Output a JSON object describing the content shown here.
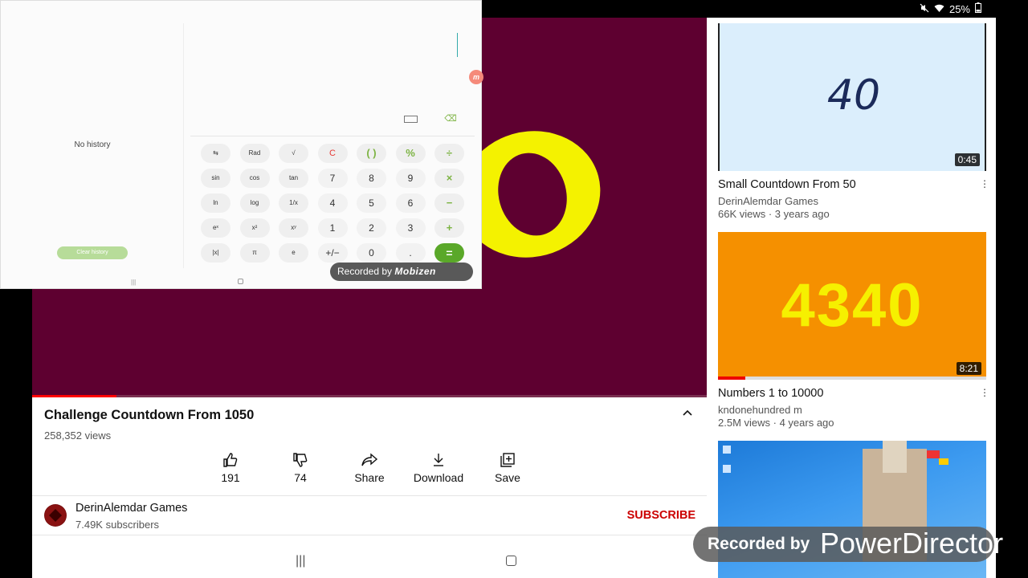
{
  "status_bar": {
    "battery": "25%"
  },
  "video": {
    "progress_fraction": 0.125
  },
  "calculator": {
    "history_empty_text": "No history",
    "clear_history_label": "Clear history",
    "keys": [
      "⇆",
      "Rad",
      "√",
      "C",
      "( )",
      "%",
      "÷",
      "sin",
      "cos",
      "tan",
      "7",
      "8",
      "9",
      "×",
      "ln",
      "log",
      "1/x",
      "4",
      "5",
      "6",
      "−",
      "eˣ",
      "x²",
      "xʸ",
      "1",
      "2",
      "3",
      "+",
      "|x|",
      "π",
      "e",
      "+/−",
      "0",
      ".",
      "="
    ],
    "watermark_prefix": "Recorded by",
    "watermark_brand": "Mobizen",
    "badge_letter": "m"
  },
  "main": {
    "title": "Challenge Countdown From 1050",
    "views": "258,352 views",
    "actions": {
      "like": "191",
      "dislike": "74",
      "share": "Share",
      "download": "Download",
      "save": "Save"
    },
    "channel": {
      "name": "DerinAlemdar Games",
      "subscribers": "7.49K subscribers",
      "subscribe": "SUBSCRIBE"
    }
  },
  "sidebar": {
    "videos": [
      {
        "thumb_text": "40",
        "duration": "0:45",
        "title": "Small Countdown From 50",
        "channel": "DerinAlemdar Games",
        "meta": "66K views · 3 years ago"
      },
      {
        "thumb_text": "4340",
        "duration": "8:21",
        "title": "Numbers 1 to 10000",
        "channel": "kndonehundred m",
        "meta": "2.5M views · 4 years ago"
      },
      {
        "thumb_text": "",
        "duration": "",
        "title": "",
        "channel": "",
        "meta": ""
      }
    ]
  },
  "watermark": {
    "prefix": "Recorded by",
    "brand": "PowerDirector"
  },
  "colors": {
    "video_bg": "#5e0030",
    "digit_yellow": "#f4f200",
    "accent_red": "#cc0000",
    "calc_green": "#5aa829"
  }
}
